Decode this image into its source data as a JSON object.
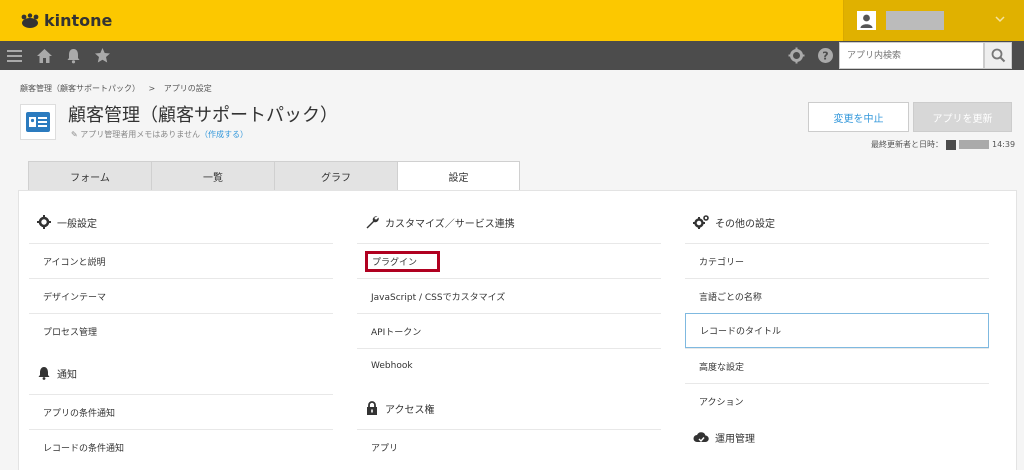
{
  "header": {
    "logo_text": "kintone",
    "colors": {
      "brand": "#fcc800",
      "toolbar": "#4c4c4c",
      "link": "#3498db",
      "highlight": "#b00020"
    }
  },
  "toolbar": {
    "icons": [
      "menu-icon",
      "home-icon",
      "bell-icon",
      "star-icon",
      "gear-icon",
      "help-icon",
      "search-icon"
    ],
    "search_placeholder": "アプリ内検索"
  },
  "breadcrumb": {
    "items": [
      "顧客管理（顧客サポートパック）",
      ">",
      "アプリの設定"
    ]
  },
  "app": {
    "title": "顧客管理（顧客サポートパック）",
    "memo": "アプリ管理者用メモはありません",
    "memo_link": "（作成する）"
  },
  "actions": {
    "cancel_label": "変更を中止",
    "update_label": "アプリを更新",
    "last_updated_label": "最終更新者と日時：",
    "last_updated_time": "14:39"
  },
  "tabs": [
    {
      "label": "フォーム"
    },
    {
      "label": "一覧"
    },
    {
      "label": "グラフ"
    },
    {
      "label": "設定",
      "active": true
    }
  ],
  "settings": {
    "general": {
      "title": "一般設定",
      "items": [
        "アイコンと説明",
        "デザインテーマ",
        "プロセス管理"
      ]
    },
    "notification": {
      "title": "通知",
      "items": [
        "アプリの条件通知",
        "レコードの条件通知"
      ]
    },
    "customize": {
      "title": "カスタマイズ／サービス連携",
      "items": [
        "プラグイン",
        "JavaScript / CSSでカスタマイズ",
        "APIトークン",
        "Webhook"
      ]
    },
    "access": {
      "title": "アクセス権",
      "items": [
        "アプリ"
      ]
    },
    "other": {
      "title": "その他の設定",
      "items": [
        "カテゴリー",
        "言語ごとの名称",
        "レコードのタイトル",
        "高度な設定",
        "アクション"
      ]
    },
    "operation": {
      "title": "運用管理"
    }
  }
}
